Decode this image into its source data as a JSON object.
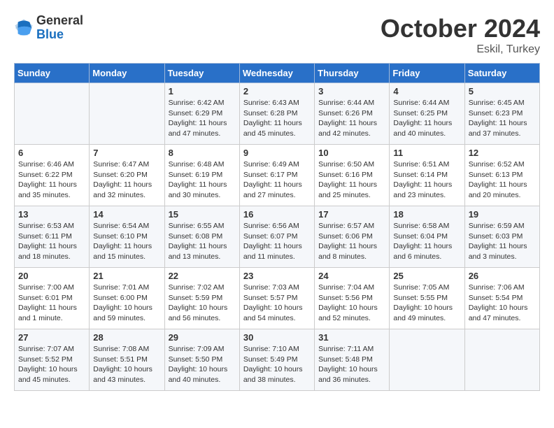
{
  "header": {
    "logo_general": "General",
    "logo_blue": "Blue",
    "month_title": "October 2024",
    "location": "Eskil, Turkey"
  },
  "days_of_week": [
    "Sunday",
    "Monday",
    "Tuesday",
    "Wednesday",
    "Thursday",
    "Friday",
    "Saturday"
  ],
  "weeks": [
    [
      {
        "day": "",
        "sunrise": "",
        "sunset": "",
        "daylight": ""
      },
      {
        "day": "",
        "sunrise": "",
        "sunset": "",
        "daylight": ""
      },
      {
        "day": "1",
        "sunrise": "Sunrise: 6:42 AM",
        "sunset": "Sunset: 6:29 PM",
        "daylight": "Daylight: 11 hours and 47 minutes."
      },
      {
        "day": "2",
        "sunrise": "Sunrise: 6:43 AM",
        "sunset": "Sunset: 6:28 PM",
        "daylight": "Daylight: 11 hours and 45 minutes."
      },
      {
        "day": "3",
        "sunrise": "Sunrise: 6:44 AM",
        "sunset": "Sunset: 6:26 PM",
        "daylight": "Daylight: 11 hours and 42 minutes."
      },
      {
        "day": "4",
        "sunrise": "Sunrise: 6:44 AM",
        "sunset": "Sunset: 6:25 PM",
        "daylight": "Daylight: 11 hours and 40 minutes."
      },
      {
        "day": "5",
        "sunrise": "Sunrise: 6:45 AM",
        "sunset": "Sunset: 6:23 PM",
        "daylight": "Daylight: 11 hours and 37 minutes."
      }
    ],
    [
      {
        "day": "6",
        "sunrise": "Sunrise: 6:46 AM",
        "sunset": "Sunset: 6:22 PM",
        "daylight": "Daylight: 11 hours and 35 minutes."
      },
      {
        "day": "7",
        "sunrise": "Sunrise: 6:47 AM",
        "sunset": "Sunset: 6:20 PM",
        "daylight": "Daylight: 11 hours and 32 minutes."
      },
      {
        "day": "8",
        "sunrise": "Sunrise: 6:48 AM",
        "sunset": "Sunset: 6:19 PM",
        "daylight": "Daylight: 11 hours and 30 minutes."
      },
      {
        "day": "9",
        "sunrise": "Sunrise: 6:49 AM",
        "sunset": "Sunset: 6:17 PM",
        "daylight": "Daylight: 11 hours and 27 minutes."
      },
      {
        "day": "10",
        "sunrise": "Sunrise: 6:50 AM",
        "sunset": "Sunset: 6:16 PM",
        "daylight": "Daylight: 11 hours and 25 minutes."
      },
      {
        "day": "11",
        "sunrise": "Sunrise: 6:51 AM",
        "sunset": "Sunset: 6:14 PM",
        "daylight": "Daylight: 11 hours and 23 minutes."
      },
      {
        "day": "12",
        "sunrise": "Sunrise: 6:52 AM",
        "sunset": "Sunset: 6:13 PM",
        "daylight": "Daylight: 11 hours and 20 minutes."
      }
    ],
    [
      {
        "day": "13",
        "sunrise": "Sunrise: 6:53 AM",
        "sunset": "Sunset: 6:11 PM",
        "daylight": "Daylight: 11 hours and 18 minutes."
      },
      {
        "day": "14",
        "sunrise": "Sunrise: 6:54 AM",
        "sunset": "Sunset: 6:10 PM",
        "daylight": "Daylight: 11 hours and 15 minutes."
      },
      {
        "day": "15",
        "sunrise": "Sunrise: 6:55 AM",
        "sunset": "Sunset: 6:08 PM",
        "daylight": "Daylight: 11 hours and 13 minutes."
      },
      {
        "day": "16",
        "sunrise": "Sunrise: 6:56 AM",
        "sunset": "Sunset: 6:07 PM",
        "daylight": "Daylight: 11 hours and 11 minutes."
      },
      {
        "day": "17",
        "sunrise": "Sunrise: 6:57 AM",
        "sunset": "Sunset: 6:06 PM",
        "daylight": "Daylight: 11 hours and 8 minutes."
      },
      {
        "day": "18",
        "sunrise": "Sunrise: 6:58 AM",
        "sunset": "Sunset: 6:04 PM",
        "daylight": "Daylight: 11 hours and 6 minutes."
      },
      {
        "day": "19",
        "sunrise": "Sunrise: 6:59 AM",
        "sunset": "Sunset: 6:03 PM",
        "daylight": "Daylight: 11 hours and 3 minutes."
      }
    ],
    [
      {
        "day": "20",
        "sunrise": "Sunrise: 7:00 AM",
        "sunset": "Sunset: 6:01 PM",
        "daylight": "Daylight: 11 hours and 1 minute."
      },
      {
        "day": "21",
        "sunrise": "Sunrise: 7:01 AM",
        "sunset": "Sunset: 6:00 PM",
        "daylight": "Daylight: 10 hours and 59 minutes."
      },
      {
        "day": "22",
        "sunrise": "Sunrise: 7:02 AM",
        "sunset": "Sunset: 5:59 PM",
        "daylight": "Daylight: 10 hours and 56 minutes."
      },
      {
        "day": "23",
        "sunrise": "Sunrise: 7:03 AM",
        "sunset": "Sunset: 5:57 PM",
        "daylight": "Daylight: 10 hours and 54 minutes."
      },
      {
        "day": "24",
        "sunrise": "Sunrise: 7:04 AM",
        "sunset": "Sunset: 5:56 PM",
        "daylight": "Daylight: 10 hours and 52 minutes."
      },
      {
        "day": "25",
        "sunrise": "Sunrise: 7:05 AM",
        "sunset": "Sunset: 5:55 PM",
        "daylight": "Daylight: 10 hours and 49 minutes."
      },
      {
        "day": "26",
        "sunrise": "Sunrise: 7:06 AM",
        "sunset": "Sunset: 5:54 PM",
        "daylight": "Daylight: 10 hours and 47 minutes."
      }
    ],
    [
      {
        "day": "27",
        "sunrise": "Sunrise: 7:07 AM",
        "sunset": "Sunset: 5:52 PM",
        "daylight": "Daylight: 10 hours and 45 minutes."
      },
      {
        "day": "28",
        "sunrise": "Sunrise: 7:08 AM",
        "sunset": "Sunset: 5:51 PM",
        "daylight": "Daylight: 10 hours and 43 minutes."
      },
      {
        "day": "29",
        "sunrise": "Sunrise: 7:09 AM",
        "sunset": "Sunset: 5:50 PM",
        "daylight": "Daylight: 10 hours and 40 minutes."
      },
      {
        "day": "30",
        "sunrise": "Sunrise: 7:10 AM",
        "sunset": "Sunset: 5:49 PM",
        "daylight": "Daylight: 10 hours and 38 minutes."
      },
      {
        "day": "31",
        "sunrise": "Sunrise: 7:11 AM",
        "sunset": "Sunset: 5:48 PM",
        "daylight": "Daylight: 10 hours and 36 minutes."
      },
      {
        "day": "",
        "sunrise": "",
        "sunset": "",
        "daylight": ""
      },
      {
        "day": "",
        "sunrise": "",
        "sunset": "",
        "daylight": ""
      }
    ]
  ]
}
